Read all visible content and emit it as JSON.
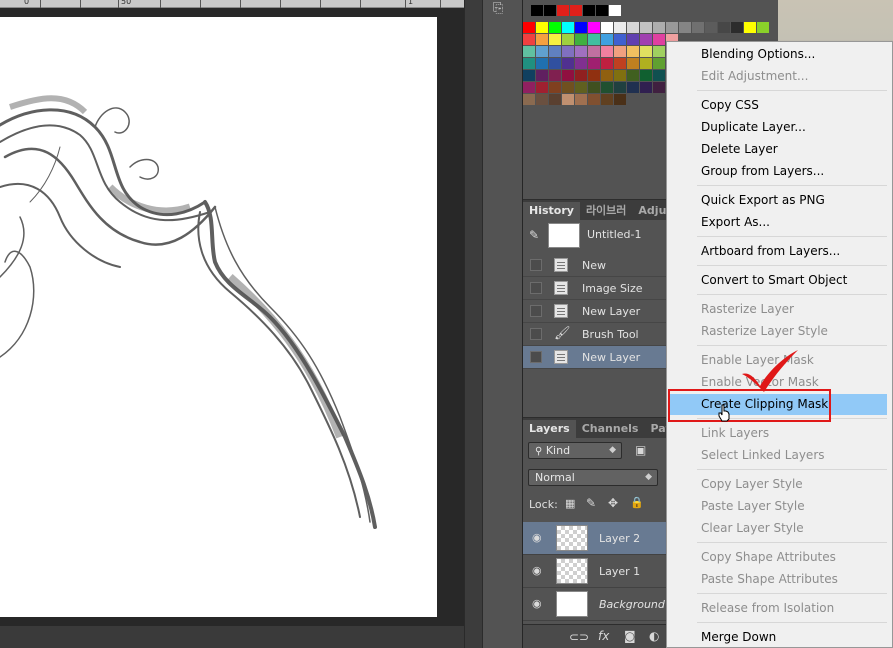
{
  "ruler": {
    "numbers": [
      "0",
      "50",
      "1"
    ]
  },
  "history_panel": {
    "tabs": [
      "History",
      "라이브러",
      "Adjus"
    ],
    "snapshot": "Untitled-1",
    "items": [
      {
        "label": "New",
        "selected": false
      },
      {
        "label": "Image Size",
        "selected": false
      },
      {
        "label": "New Layer",
        "selected": false
      },
      {
        "label": "Brush Tool",
        "selected": false
      },
      {
        "label": "New Layer",
        "selected": true
      }
    ]
  },
  "layers_panel": {
    "tabs": [
      "Layers",
      "Channels",
      "Paths"
    ],
    "filter_kind": "Kind",
    "blend_mode": "Normal",
    "lock_label": "Lock:",
    "layers": [
      {
        "name": "Layer 2",
        "selected": true
      },
      {
        "name": "Layer 1",
        "selected": false
      },
      {
        "name": "Background",
        "selected": false
      }
    ],
    "footer_icons": [
      "link-icon",
      "fx-icon",
      "mask-icon",
      "adjustment-icon"
    ]
  },
  "context_menu": {
    "items": [
      {
        "label": "Blending Options...",
        "disabled": false
      },
      {
        "label": "Edit Adjustment...",
        "disabled": true
      },
      {
        "label": "Copy CSS",
        "disabled": false
      },
      {
        "label": "Duplicate Layer...",
        "disabled": false
      },
      {
        "label": "Delete Layer",
        "disabled": false
      },
      {
        "label": "Group from Layers...",
        "disabled": false
      },
      {
        "label": "Quick Export as PNG",
        "disabled": false
      },
      {
        "label": "Export As...",
        "disabled": false
      },
      {
        "label": "Artboard from Layers...",
        "disabled": false
      },
      {
        "label": "Convert to Smart Object",
        "disabled": false
      },
      {
        "label": "Rasterize Layer",
        "disabled": true
      },
      {
        "label": "Rasterize Layer Style",
        "disabled": true
      },
      {
        "label": "Enable Layer Mask",
        "disabled": true
      },
      {
        "label": "Enable Vector Mask",
        "disabled": true
      },
      {
        "label": "Create Clipping Mask",
        "disabled": false,
        "highlighted": true
      },
      {
        "label": "Link Layers",
        "disabled": true
      },
      {
        "label": "Select Linked Layers",
        "disabled": true
      },
      {
        "label": "Copy Layer Style",
        "disabled": true
      },
      {
        "label": "Paste Layer Style",
        "disabled": true
      },
      {
        "label": "Clear Layer Style",
        "disabled": true
      },
      {
        "label": "Copy Shape Attributes",
        "disabled": true
      },
      {
        "label": "Paste Shape Attributes",
        "disabled": true
      },
      {
        "label": "Release from Isolation",
        "disabled": true
      },
      {
        "label": "Merge Down",
        "disabled": false
      }
    ]
  },
  "colors": {
    "highlight": "#91c9f7",
    "annotation": "#e01818",
    "selection": "#687a92"
  }
}
